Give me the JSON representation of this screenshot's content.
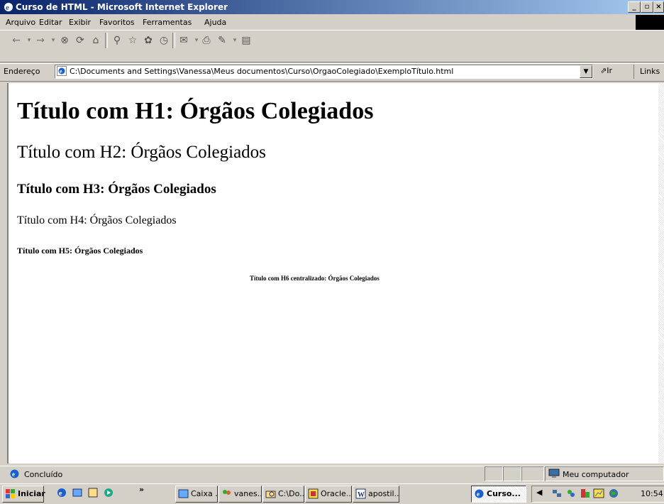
{
  "window": {
    "title": "Curso de HTML - Microsoft Internet Explorer",
    "controls": [
      "_",
      "▫",
      "×"
    ]
  },
  "menu": [
    "Arquivo",
    "Editar",
    "Exibir",
    "Favoritos",
    "Ferramentas",
    "Ajuda"
  ],
  "toolbar_icons": [
    "back-icon",
    "forward-icon",
    "stop-icon",
    "refresh-icon",
    "home-icon",
    "search-icon",
    "favorites-icon",
    "media-icon",
    "history-icon",
    "mail-icon",
    "print-icon",
    "edit-icon",
    "discuss-icon"
  ],
  "address": {
    "label": "Endereço",
    "value": "C:\\Documents and Settings\\Vanessa\\Meus documentos\\Curso\\OrgaoColegiado\\ExemploTítulo.html",
    "go_label": "Ir",
    "links_label": "Links"
  },
  "page": {
    "h1": "Título com H1: Órgãos Colegiados",
    "h2": "Título com H2: Órgãos Colegiados",
    "h3": "Título com H3: Órgãos Colegiados",
    "h4": "Título com H4: Órgãos Colegiados",
    "h5": "Título com H5: Órgãos Colegiados",
    "h6": "Título com H6 centralizado: Órgãos Colegiados"
  },
  "status": {
    "text": "Concluído",
    "zone": "Meu computador"
  },
  "taskbar": {
    "start_label": "Iniciar",
    "chevron": "»",
    "tasks": [
      {
        "label": "Caixa ...",
        "active": false
      },
      {
        "label": "vanes...",
        "active": false
      },
      {
        "label": "C:\\Do...",
        "active": false
      },
      {
        "label": "Oracle...",
        "active": false
      },
      {
        "label": "apostil...",
        "active": false
      },
      {
        "label": "Curso...",
        "active": true
      }
    ],
    "clock": "10:54"
  }
}
